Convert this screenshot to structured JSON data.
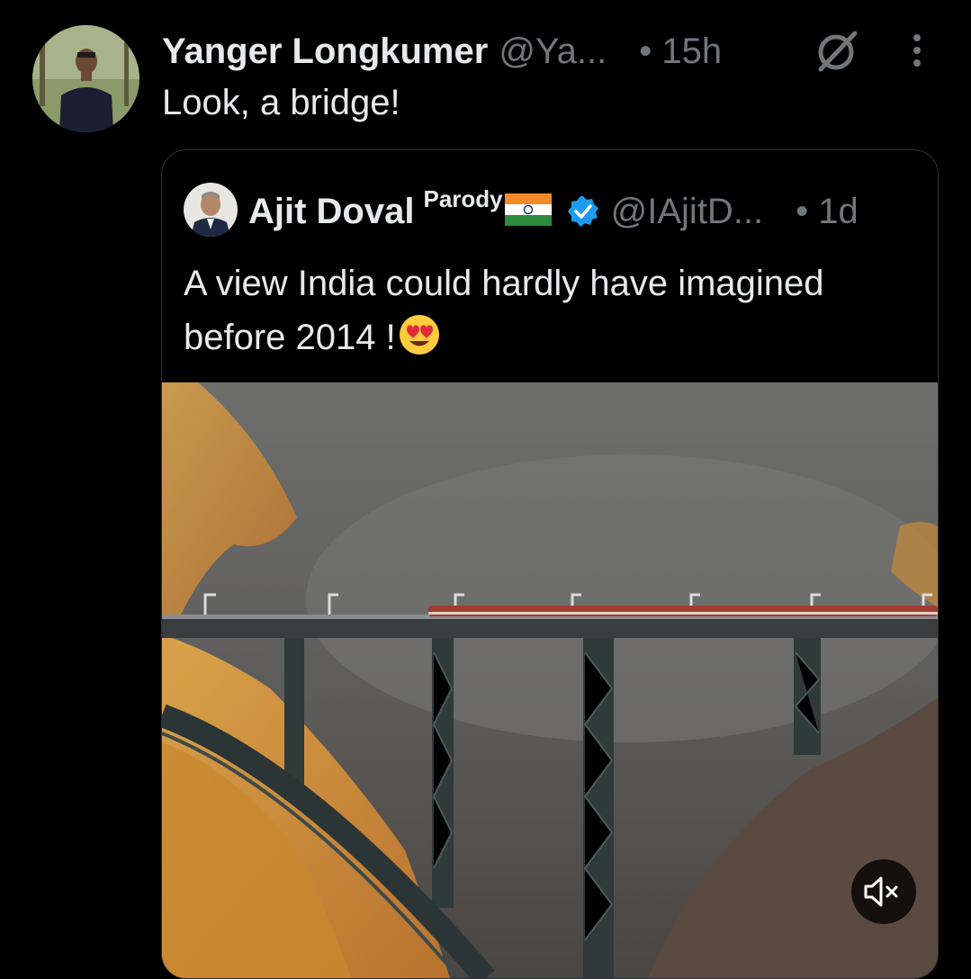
{
  "post": {
    "author_name": "Yanger Longkumer",
    "author_handle": "@Ya...",
    "time": "• 15h",
    "text": "Look, a bridge!",
    "icons": [
      "avatar-photo",
      "grok-icon",
      "more-vertical-icon"
    ]
  },
  "quoted_post": {
    "author_name": "Ajit Doval",
    "label": "Parody",
    "author_handle": "@IAjitD...",
    "time": "• 1d",
    "text": "A view India could hardly have imagined before 2014 !",
    "icons": [
      "india-flag-emoji",
      "verified-badge-icon",
      "heart-eyes-emoji"
    ],
    "media": "video of train crossing a steel arch railway bridge over a misty valley with autumn foliage"
  },
  "colors": {
    "background": "#000000",
    "text_primary": "#e7e9ea",
    "text_secondary": "#71767b",
    "border": "#2f3336",
    "verified": "#1d9bf0"
  },
  "video_controls": {
    "mute": "muted-speaker-icon"
  }
}
